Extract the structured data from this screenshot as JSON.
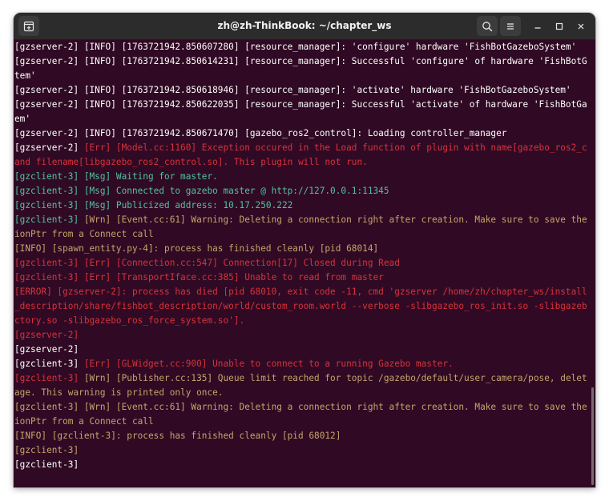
{
  "window": {
    "title": "zh@zh-ThinkBook: ~/chapter_ws"
  },
  "icons": {
    "new_tab": "new-tab-icon",
    "search": "search-icon",
    "menu": "hamburger-menu-icon",
    "minimize": "minimize-icon",
    "maximize": "maximize-icon",
    "close": "close-icon"
  },
  "colors": {
    "terminal_bg": "#300a24",
    "titlebar_bg": "#2c2c2c",
    "white": "#ffffff",
    "red": "#d8323c",
    "green": "#52c2a0",
    "yellow": "#c6a46b"
  },
  "lines": [
    {
      "segments": [
        {
          "text": "[gzserver-2] [INFO] [1763721942.850607280] [resource_manager]: 'configure' hardware 'FishBotGazeboSystem'",
          "color": "white"
        }
      ]
    },
    {
      "segments": [
        {
          "text": "[gzserver-2] [INFO] [1763721942.850614231] [resource_manager]: Successful 'configure' of hardware 'FishBotGazeboSys",
          "color": "white"
        }
      ]
    },
    {
      "segments": [
        {
          "text": "tem'",
          "color": "white"
        }
      ]
    },
    {
      "segments": [
        {
          "text": "[gzserver-2] [INFO] [1763721942.850618946] [resource_manager]: 'activate' hardware 'FishBotGazeboSystem'",
          "color": "white"
        }
      ]
    },
    {
      "segments": [
        {
          "text": "[gzserver-2] [INFO] [1763721942.850622035] [resource_manager]: Successful 'activate' of hardware 'FishBotGazeboSyst",
          "color": "white"
        }
      ]
    },
    {
      "segments": [
        {
          "text": "em'",
          "color": "white"
        }
      ]
    },
    {
      "segments": [
        {
          "text": "[gzserver-2] [INFO] [1763721942.850671470] [gazebo_ros2_control]: Loading controller_manager",
          "color": "white"
        }
      ]
    },
    {
      "segments": [
        {
          "text": "[gzserver-2] ",
          "color": "white"
        },
        {
          "text": "[Err] [Model.cc:1160] Exception occured in the Load function of plugin with name[gazebo_ros2_control]",
          "color": "red"
        }
      ]
    },
    {
      "segments": [
        {
          "text": "and filename[libgazebo_ros2_control.so]. This plugin will not run.",
          "color": "red"
        }
      ]
    },
    {
      "segments": [
        {
          "text": "[gzclient-3] [Msg] Waiting for master.",
          "color": "green"
        }
      ]
    },
    {
      "segments": [
        {
          "text": "[gzclient-3] [Msg] Connected to gazebo master @ http://127.0.0.1:11345",
          "color": "green"
        }
      ]
    },
    {
      "segments": [
        {
          "text": "[gzclient-3] [Msg] Publicized address: 10.17.250.222",
          "color": "green"
        }
      ]
    },
    {
      "segments": [
        {
          "text": "[gzclient-3] ",
          "color": "green"
        },
        {
          "text": "[Wrn] [Event.cc:61] Warning: Deleting a connection right after creation. Make sure to save the Connect",
          "color": "yellow"
        }
      ]
    },
    {
      "segments": [
        {
          "text": "ionPtr from a Connect call",
          "color": "yellow"
        }
      ]
    },
    {
      "segments": [
        {
          "text": "[INFO] [spawn_entity.py-4]: process has finished cleanly [pid 68014]",
          "color": "yellow"
        }
      ]
    },
    {
      "segments": [
        {
          "text": "[gzclient-3] [Err] [Connection.cc:547] Connection[17] Closed during Read",
          "color": "red"
        }
      ]
    },
    {
      "segments": [
        {
          "text": "[gzclient-3] [Err] [TransportIface.cc:385] Unable to read from master",
          "color": "red"
        }
      ]
    },
    {
      "segments": [
        {
          "text": "[ERROR] [gzserver-2]: process has died [pid 68010, exit code -11, cmd 'gzserver /home/zh/chapter_ws/install/fishbot",
          "color": "red"
        }
      ]
    },
    {
      "segments": [
        {
          "text": "_description/share/fishbot_description/world/custom_room.world --verbose -slibgazebo_ros_init.so -slibgazebo_ros_fa",
          "color": "red"
        }
      ]
    },
    {
      "segments": [
        {
          "text": "ctory.so -slibgazebo_ros_force_system.so'].",
          "color": "red"
        }
      ]
    },
    {
      "segments": [
        {
          "text": "[gzserver-2]",
          "color": "red"
        }
      ]
    },
    {
      "segments": [
        {
          "text": "[gzserver-2]",
          "color": "white"
        }
      ]
    },
    {
      "segments": [
        {
          "text": "[gzclient-3] ",
          "color": "white"
        },
        {
          "text": "[Err] [GLWidget.cc:900] Unable to connect to a running Gazebo master.",
          "color": "red"
        }
      ]
    },
    {
      "segments": [
        {
          "text": "[gzclient-3] ",
          "color": "red"
        },
        {
          "text": "[Wrn] [Publisher.cc:135] Queue limit reached for topic /gazebo/default/user_camera/pose, deleting mess",
          "color": "yellow"
        }
      ]
    },
    {
      "segments": [
        {
          "text": "age. This warning is printed only once.",
          "color": "yellow"
        }
      ]
    },
    {
      "segments": [
        {
          "text": "[gzclient-3] [Wrn] [Event.cc:61] Warning: Deleting a connection right after creation. Make sure to save the Connect",
          "color": "yellow"
        }
      ]
    },
    {
      "segments": [
        {
          "text": "ionPtr from a Connect call",
          "color": "yellow"
        }
      ]
    },
    {
      "segments": [
        {
          "text": "[INFO] [gzclient-3]: process has finished cleanly [pid 68012]",
          "color": "yellow"
        }
      ]
    },
    {
      "segments": [
        {
          "text": "[gzclient-3]",
          "color": "yellow"
        }
      ]
    },
    {
      "segments": [
        {
          "text": "[gzclient-3]",
          "color": "white"
        }
      ]
    }
  ]
}
